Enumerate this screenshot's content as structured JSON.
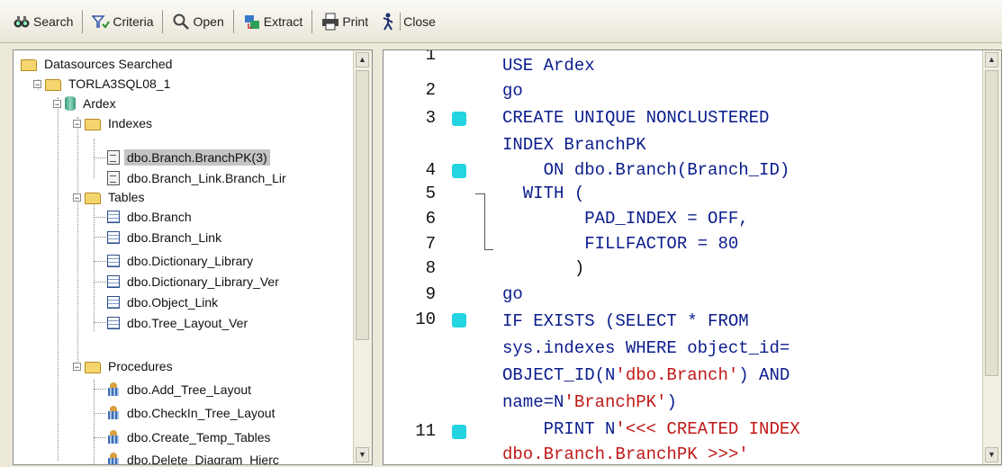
{
  "toolbar": {
    "search": "Search",
    "criteria": "Criteria",
    "open": "Open",
    "extract": "Extract",
    "print": "Print",
    "close": "Close"
  },
  "tree": {
    "root": "Datasources Searched",
    "server": "TORLA3SQL08_1",
    "database": "Ardex",
    "indexes_folder": "Indexes",
    "indexes": [
      "dbo.Branch.BranchPK(3)",
      "dbo.Branch_Link.Branch_Lir"
    ],
    "tables_folder": "Tables",
    "tables": [
      "dbo.Branch",
      "dbo.Branch_Link",
      "dbo.Dictionary_Library",
      "dbo.Dictionary_Library_Ver",
      "dbo.Object_Link",
      "dbo.Tree_Layout_Ver"
    ],
    "procedures_folder": "Procedures",
    "procedures": [
      "dbo.Add_Tree_Layout",
      "dbo.CheckIn_Tree_Layout",
      "dbo.Create_Temp_Tables",
      "dbo.Delete_Diagram_Hierc"
    ]
  },
  "code": {
    "line_numbers": [
      "1",
      "2",
      "3",
      "4",
      "5",
      "6",
      "7",
      "8",
      "9",
      "10",
      "11"
    ],
    "lines": [
      "USE Ardex",
      "go",
      "CREATE UNIQUE NONCLUSTERED",
      "INDEX BranchPK",
      "    ON dbo.Branch(Branch_ID)",
      "  WITH (",
      "        PAD_INDEX = OFF,",
      "        FILLFACTOR = 80",
      "       )",
      "go",
      "IF EXISTS (SELECT * FROM",
      "sys.indexes WHERE object_id=",
      "OBJECT_ID(N",
      "'dbo.Branch'",
      ") AND",
      "name=N",
      "'BranchPK'",
      ")",
      "    PRINT N",
      "'<<< CREATED INDEX",
      "dbo.Branch.BranchPK >>>'"
    ]
  },
  "colors": {
    "keyword": "#0A1C8C",
    "string": "#C01818",
    "marker": "#24D4E0",
    "selection": "#C4C4C4"
  }
}
